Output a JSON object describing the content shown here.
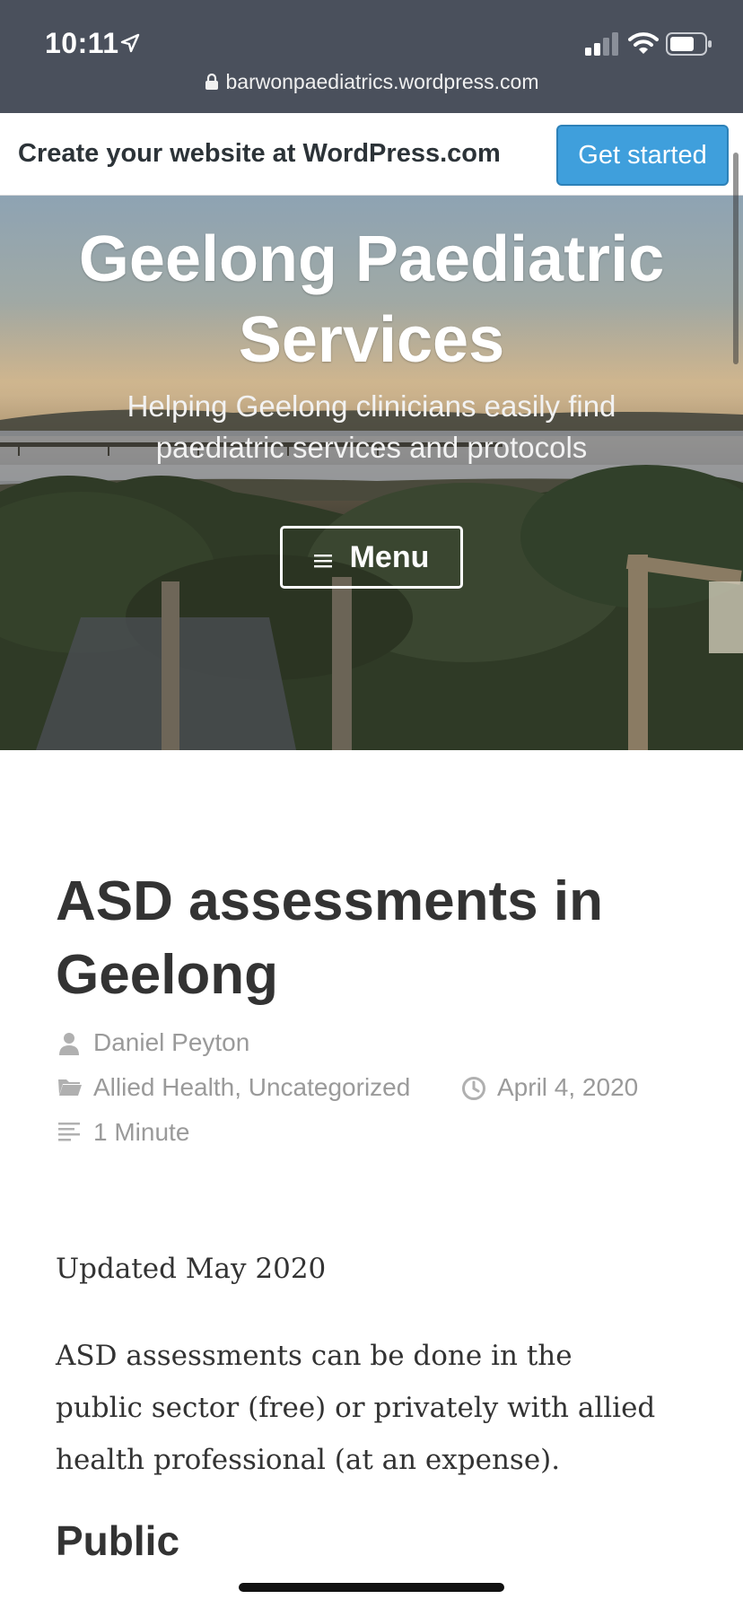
{
  "status_bar": {
    "time": "10:11",
    "url": "barwonpaediatrics.wordpress.com"
  },
  "wp_banner": {
    "text": "Create your website at WordPress.com",
    "button": "Get started"
  },
  "header": {
    "site_title": "Geelong Paediatric Services",
    "tagline": "Helping Geelong clinicians easily find paediatric services and protocols",
    "menu_label": "Menu"
  },
  "post": {
    "title": "ASD assessments in Geelong",
    "author": "Daniel Peyton",
    "categories": "Allied Health, Uncategorized",
    "date": "April 4, 2020",
    "reading_time": "1 Minute",
    "updated": "Updated May 2020",
    "intro": "ASD assessments can be done in the public sector (free) or privately with allied health professional (at an expense).",
    "section_heading": "Public"
  },
  "colors": {
    "status_bar": "#4a505c",
    "wp_button": "#3f9fdc",
    "title_text": "#333333",
    "meta_text": "#9a9a9a"
  }
}
